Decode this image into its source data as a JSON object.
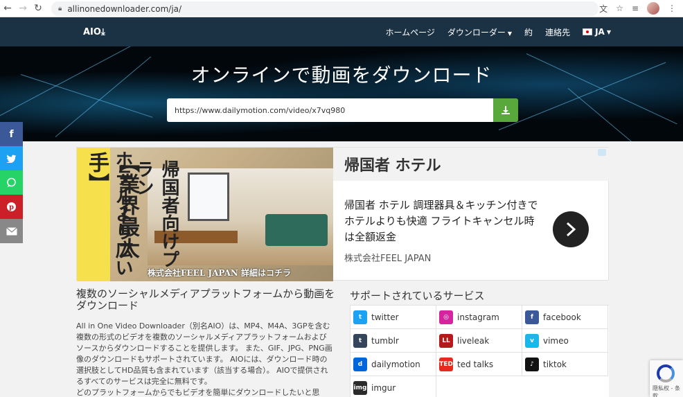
{
  "browser": {
    "url": "allinonedownloader.com/ja/"
  },
  "navbar": {
    "logo": "AIO⤓",
    "items": [
      {
        "label": "ホームページ"
      },
      {
        "label": "ダウンローダー",
        "has_caret": true
      },
      {
        "label": "約"
      },
      {
        "label": "連絡先"
      }
    ],
    "language": "JA"
  },
  "hero": {
    "title": "オンラインで動画をダウンロード",
    "input_value": "https://www.dailymotion.com/video/x7vq980"
  },
  "social": [
    "f",
    "twitter",
    "whatsapp",
    "pinterest",
    "email"
  ],
  "ad": {
    "image_text_1": "【業界最大手】",
    "image_text_2": "ホテルより広い",
    "image_text_3": "帰国者向けプラン",
    "image_caption": "株式会社FEEL JAPAN 詳細はコチラ",
    "title": "帰国者 ホテル",
    "body": "帰国者 ホテル 調理器具＆キッチン付きでホテルよりも快適 フライトキャンセル時は全額返金",
    "company": "株式会社FEEL JAPAN"
  },
  "content": {
    "title": "複数のソーシャルメディアプラットフォームから動画をダウンロード",
    "paragraph": "All in One Video Downloader（別名AIO）は、MP4、M4A、3GPを含む複数の形式のビデオを複数のソーシャルメディアプラットフォームおよびソースからダウンロードすることを提供します。 また、GIF、JPG、PNG画像のダウンロードもサポートされています。 AIOには、ダウンロード時の選択肢としてHD品質も含まれています（該当する場合）。 AIOで提供されるすべてのサービスは完全に無料です。",
    "paragraph_cut": "どのプラットフォームからでもビデオを簡単にダウンロードしたいと思"
  },
  "services": {
    "title": "サポートされているサービス",
    "items": [
      {
        "label": "twitter",
        "color": "#1da1f2"
      },
      {
        "label": "instagram",
        "color": "#d6249f"
      },
      {
        "label": "facebook",
        "color": "#3b5998"
      },
      {
        "label": "tumblr",
        "color": "#35465c"
      },
      {
        "label": "liveleak",
        "color": "#b31b1b"
      },
      {
        "label": "vimeo",
        "color": "#1ab7ea"
      },
      {
        "label": "dailymotion",
        "color": "#0066dc"
      },
      {
        "label": "ted talks",
        "color": "#e62b1e"
      },
      {
        "label": "tiktok",
        "color": "#111111"
      },
      {
        "label": "imgur",
        "color": "#2b2b2b"
      }
    ]
  },
  "recaptcha": {
    "text": "隠私权 - 条款"
  }
}
